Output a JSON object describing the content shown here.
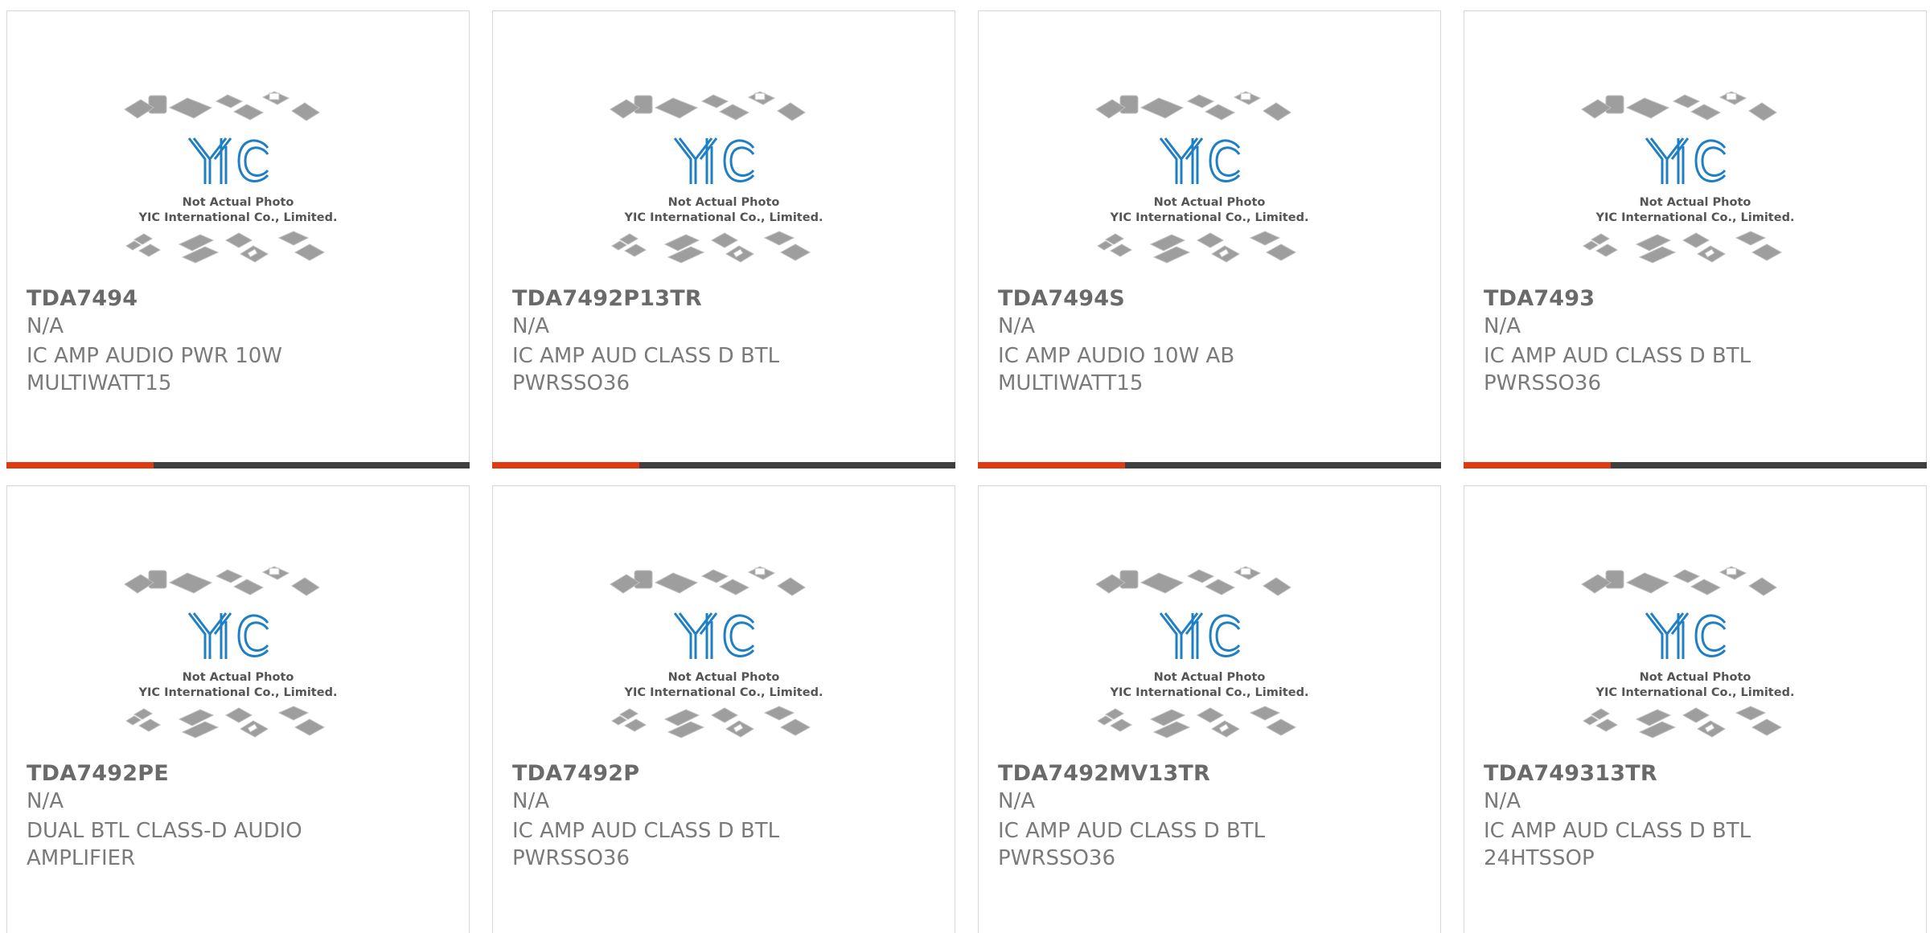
{
  "products": [
    {
      "part": "TDA7494",
      "manufacturer": "N/A",
      "description_line1": "IC AMP AUDIO PWR 10W",
      "description_line2": "MULTIWATT15"
    },
    {
      "part": "TDA7492P13TR",
      "manufacturer": "N/A",
      "description_line1": "IC AMP AUD CLASS D BTL",
      "description_line2": "PWRSSO36"
    },
    {
      "part": "TDA7494S",
      "manufacturer": "N/A",
      "description_line1": "IC AMP AUDIO 10W AB",
      "description_line2": "MULTIWATT15"
    },
    {
      "part": "TDA7493",
      "manufacturer": "N/A",
      "description_line1": "IC AMP AUD CLASS D BTL",
      "description_line2": "PWRSSO36"
    },
    {
      "part": "TDA7492PE",
      "manufacturer": "N/A",
      "description_line1": "DUAL BTL CLASS-D AUDIO",
      "description_line2": "AMPLIFIER"
    },
    {
      "part": "TDA7492P",
      "manufacturer": "N/A",
      "description_line1": "IC AMP AUD CLASS D BTL",
      "description_line2": "PWRSSO36"
    },
    {
      "part": "TDA7492MV13TR",
      "manufacturer": "N/A",
      "description_line1": "IC AMP AUD CLASS D BTL",
      "description_line2": "PWRSSO36"
    },
    {
      "part": "TDA749313TR",
      "manufacturer": "N/A",
      "description_line1": "IC AMP AUD CLASS D BTL",
      "description_line2": "24HTSSOP"
    }
  ],
  "placeholder_image": {
    "logo_text": "YIC",
    "note_line1": "Not Actual Photo",
    "note_line2": "YIC International Co., Limited.",
    "icon": "chip-packages-placeholder-icon"
  },
  "colors": {
    "accent": "#e03a12",
    "bar": "#3f3f3f",
    "logo_blue": "#1f7fc4",
    "text_gray": "#6a6a6a"
  }
}
